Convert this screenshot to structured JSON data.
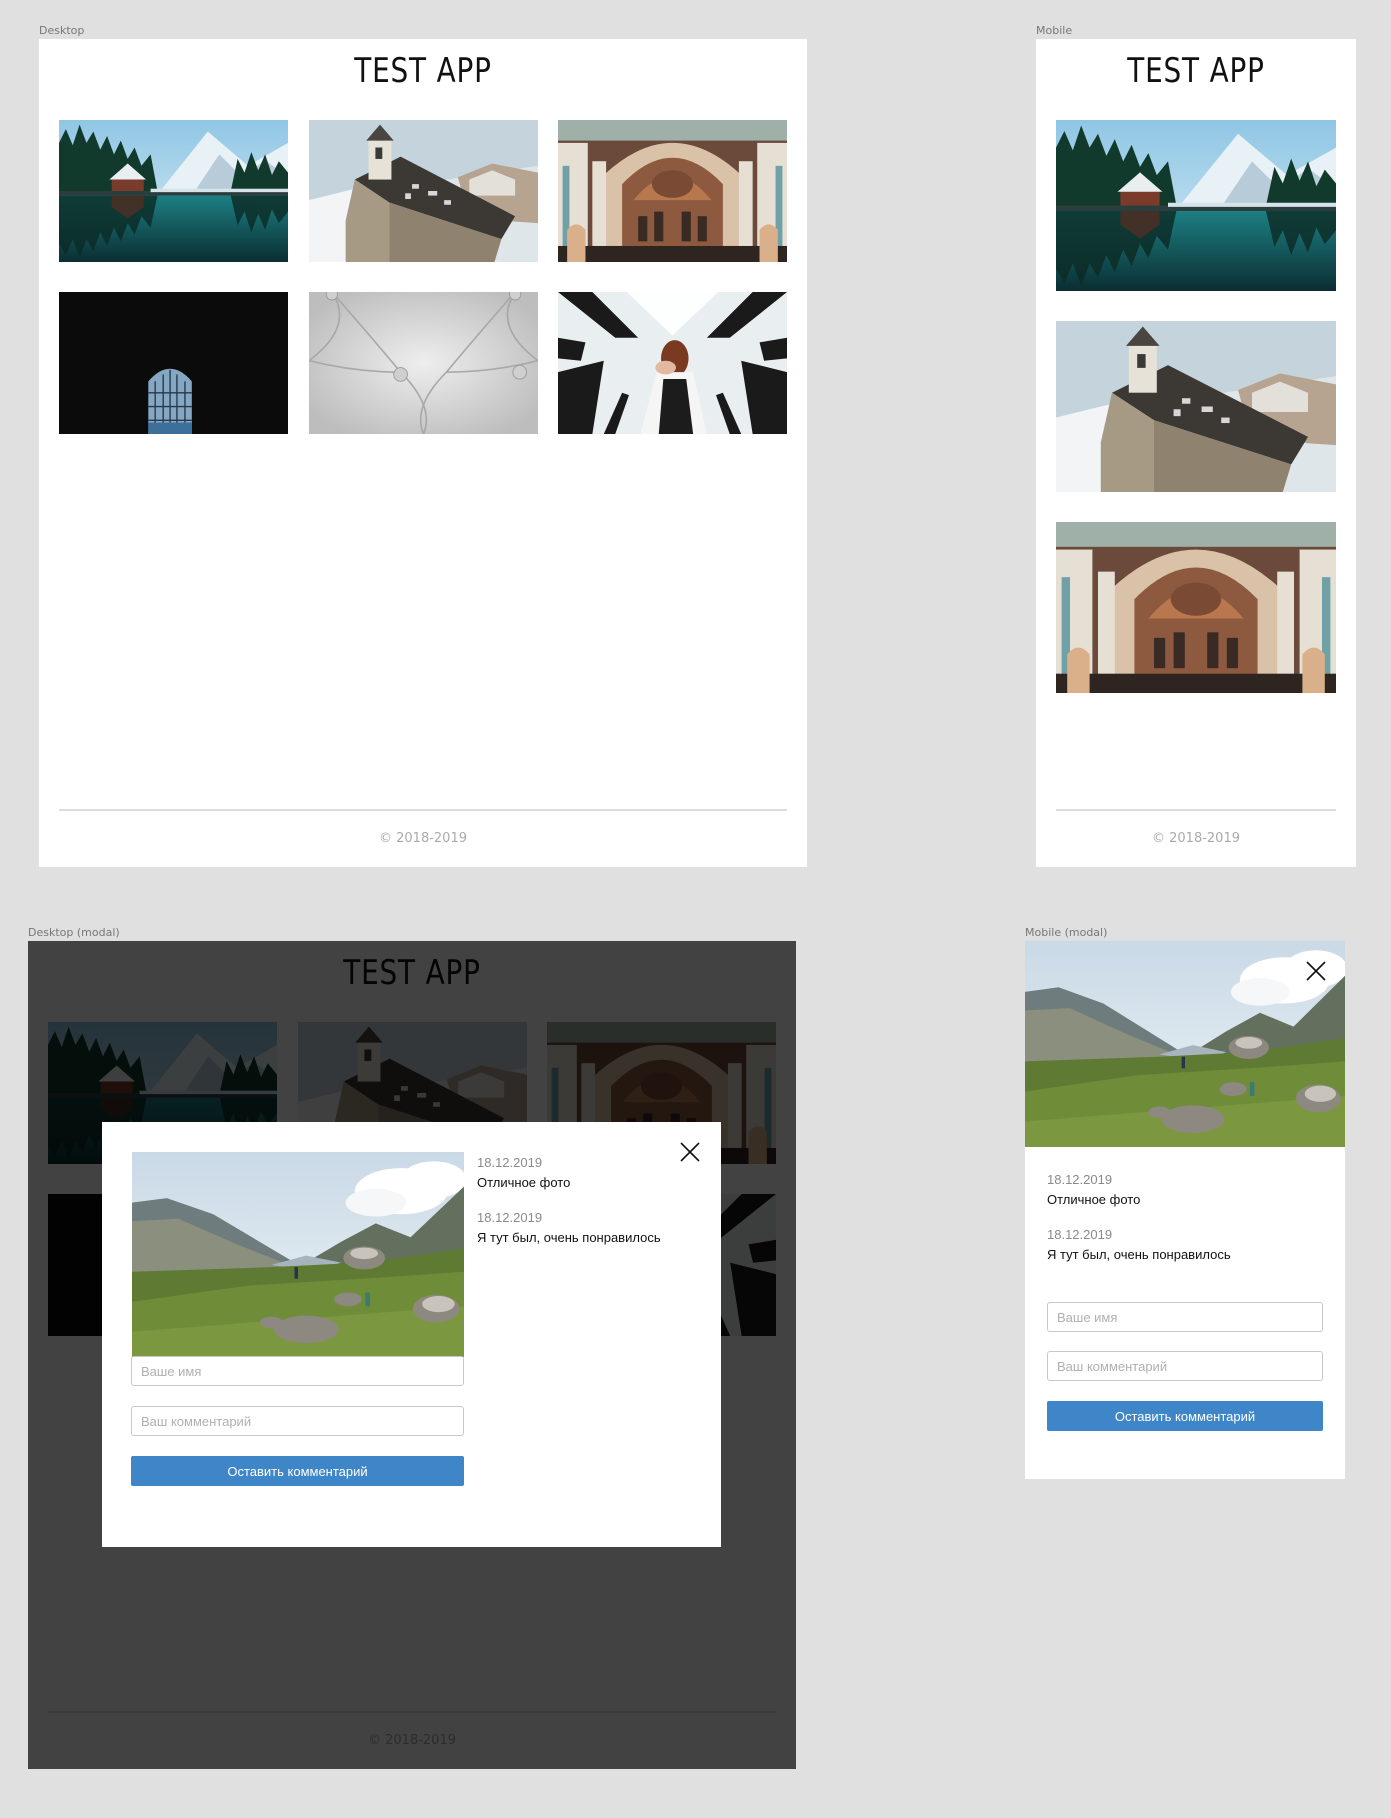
{
  "frames": {
    "desktop": "Desktop",
    "mobile": "Mobile",
    "desktop_modal": "Desktop (modal)",
    "mobile_modal": "Mobile (modal)"
  },
  "app": {
    "title": "TEST APP",
    "footer": "© 2018-2019"
  },
  "gallery": [
    {
      "name": "mountain-lake-photo"
    },
    {
      "name": "chapel-in-snow-photo"
    },
    {
      "name": "cathedral-interior-photo"
    },
    {
      "name": "dark-arched-window-photo"
    },
    {
      "name": "white-tufted-leather-photo"
    },
    {
      "name": "woman-in-striped-hall-photo"
    }
  ],
  "modal": {
    "image": "mountain-valley-hikers-photo",
    "close_icon": "close-icon",
    "comments": [
      {
        "date": "18.12.2019",
        "text": "Отличное фото"
      },
      {
        "date": "18.12.2019",
        "text": "Я тут был, очень понравилось"
      }
    ],
    "form": {
      "name_placeholder": "Ваше имя",
      "comment_placeholder": "Ваш комментарий",
      "submit_label": "Оставить комментарий"
    }
  },
  "colors": {
    "canvas": "#e0e0e0",
    "frame": "#ffffff",
    "accent": "#3f86c8",
    "footer_text": "#aaaaaa",
    "overlay": "rgba(0,0,0,0.74)"
  }
}
